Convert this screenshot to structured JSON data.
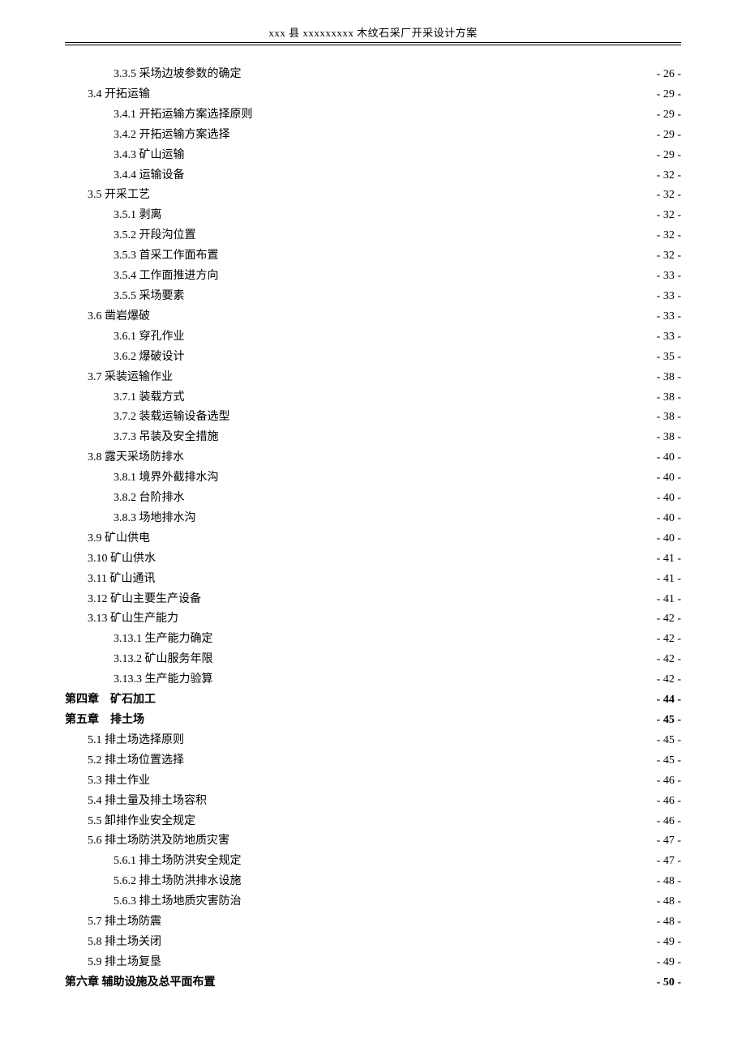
{
  "header": "xxx 县 xxxxxxxxx 木纹石采厂开采设计方案",
  "toc": [
    {
      "label": "3.3.5 采场边坡参数的确定",
      "page": "- 26 -",
      "indent": 2
    },
    {
      "label": "3.4 开拓运输",
      "page": "- 29 -",
      "indent": 1
    },
    {
      "label": "3.4.1 开拓运输方案选择原则",
      "page": "- 29 -",
      "indent": 2
    },
    {
      "label": "3.4.2 开拓运输方案选择",
      "page": "- 29 -",
      "indent": 2
    },
    {
      "label": "3.4.3 矿山运输",
      "page": "- 29 -",
      "indent": 2
    },
    {
      "label": "3.4.4 运输设备",
      "page": "- 32 -",
      "indent": 2
    },
    {
      "label": "3.5 开采工艺",
      "page": "- 32 -",
      "indent": 1
    },
    {
      "label": "3.5.1 剥离",
      "page": "- 32 -",
      "indent": 2
    },
    {
      "label": "3.5.2 开段沟位置",
      "page": "- 32 -",
      "indent": 2
    },
    {
      "label": "3.5.3 首采工作面布置",
      "page": "- 32 -",
      "indent": 2
    },
    {
      "label": "3.5.4 工作面推进方向",
      "page": "- 33 -",
      "indent": 2
    },
    {
      "label": "3.5.5 采场要素",
      "page": "- 33 -",
      "indent": 2
    },
    {
      "label": "3.6 凿岩爆破",
      "page": "- 33 -",
      "indent": 1
    },
    {
      "label": "3.6.1 穿孔作业",
      "page": "- 33 -",
      "indent": 2
    },
    {
      "label": "3.6.2 爆破设计",
      "page": "- 35 -",
      "indent": 2
    },
    {
      "label": "3.7 采装运输作业",
      "page": "- 38 -",
      "indent": 1
    },
    {
      "label": "3.7.1 装载方式",
      "page": "- 38 -",
      "indent": 2
    },
    {
      "label": "3.7.2 装载运输设备选型",
      "page": "- 38 -",
      "indent": 2
    },
    {
      "label": "3.7.3 吊装及安全措施",
      "page": "- 38 -",
      "indent": 2
    },
    {
      "label": "3.8 露天采场防排水",
      "page": "- 40 -",
      "indent": 1
    },
    {
      "label": "3.8.1 境界外截排水沟",
      "page": "- 40 -",
      "indent": 2
    },
    {
      "label": "3.8.2 台阶排水",
      "page": "- 40 -",
      "indent": 2
    },
    {
      "label": "3.8.3 场地排水沟",
      "page": "- 40 -",
      "indent": 2
    },
    {
      "label": "3.9 矿山供电",
      "page": "- 40 -",
      "indent": 1
    },
    {
      "label": "3.10 矿山供水",
      "page": "- 41 -",
      "indent": 1
    },
    {
      "label": "3.11 矿山通讯",
      "page": "- 41 -",
      "indent": 1
    },
    {
      "label": "3.12 矿山主要生产设备",
      "page": "- 41 -",
      "indent": 1
    },
    {
      "label": "3.13 矿山生产能力",
      "page": "- 42 -",
      "indent": 1
    },
    {
      "label": "3.13.1 生产能力确定",
      "page": "- 42 -",
      "indent": 2
    },
    {
      "label": "3.13.2 矿山服务年限",
      "page": "- 42 -",
      "indent": 2
    },
    {
      "label": "3.13.3 生产能力验算",
      "page": "- 42 -",
      "indent": 2
    },
    {
      "label": "第四章　矿石加工",
      "page": "- 44 -",
      "indent": 0,
      "bold": true
    },
    {
      "label": "第五章　排土场",
      "page": "- 45 -",
      "indent": 0,
      "bold": true
    },
    {
      "label": "5.1 排土场选择原则",
      "page": "- 45 -",
      "indent": 1
    },
    {
      "label": "5.2 排土场位置选择",
      "page": "- 45 -",
      "indent": 1
    },
    {
      "label": "5.3 排土作业",
      "page": "- 46 -",
      "indent": 1
    },
    {
      "label": "5.4 排土量及排土场容积",
      "page": "- 46 -",
      "indent": 1
    },
    {
      "label": "5.5 卸排作业安全规定",
      "page": "- 46 -",
      "indent": 1
    },
    {
      "label": "5.6 排土场防洪及防地质灾害",
      "page": "- 47 -",
      "indent": 1
    },
    {
      "label": "5.6.1 排土场防洪安全规定",
      "page": "- 47 -",
      "indent": 2
    },
    {
      "label": "5.6.2 排土场防洪排水设施",
      "page": "- 48 -",
      "indent": 2
    },
    {
      "label": "5.6.3 排土场地质灾害防治",
      "page": "- 48 -",
      "indent": 2
    },
    {
      "label": "5.7 排土场防震",
      "page": "- 48 -",
      "indent": 1
    },
    {
      "label": "5.8 排土场关闭",
      "page": "- 49 -",
      "indent": 1
    },
    {
      "label": "5.9 排土场复垦",
      "page": "- 49 -",
      "indent": 1
    },
    {
      "label": "第六章 辅助设施及总平面布置",
      "page": "- 50 -",
      "indent": 0,
      "bold": true
    }
  ]
}
